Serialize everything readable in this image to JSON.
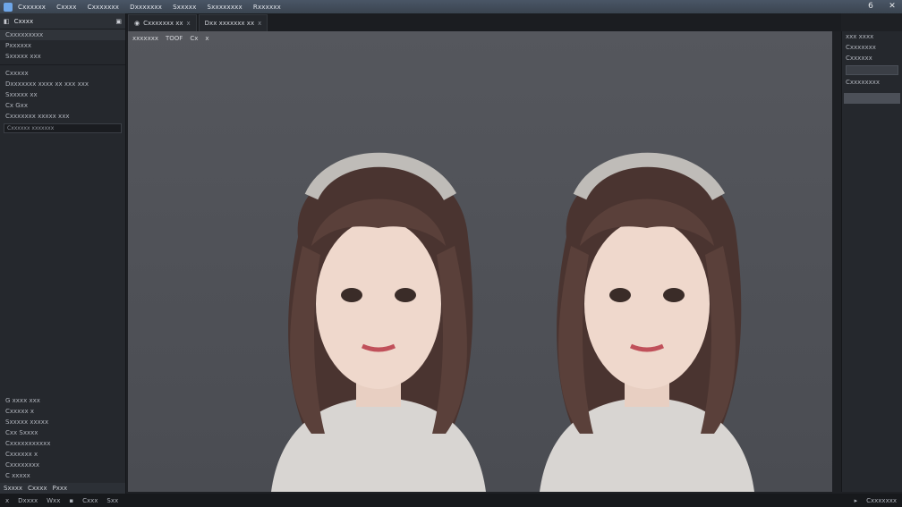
{
  "menubar": {
    "items": [
      "Cxxxxxx",
      "Cxxxx",
      "Cxxxxxxx",
      "Dxxxxxxx",
      "Sxxxxx",
      "Sxxxxxxxx",
      "Rxxxxxx"
    ],
    "counter": "6"
  },
  "left_panel": {
    "header_title": "Cxxxx",
    "rows": [
      "Cxxxxxxxxx",
      "Pxxxxxx",
      "Sxxxxx xxx",
      "Cxxxxx",
      "Dxxxxxxx xxxx xx xxx xxx",
      "Sxxxxx xx",
      "Cx Gxx",
      "Cxxxxxxx xxxxx xxx"
    ],
    "input_value": "Cxxxxxx xxxxxxx",
    "bottom_rows": [
      "G xxxx xxx",
      "Cxxxxx x",
      "Sxxxxx xxxxx",
      "Cxx Sxxxx",
      "Cxxxxxxxxxxx",
      "Cxxxxxx x",
      "Cxxxxxxxx",
      "C xxxxx"
    ],
    "footer": [
      "Sxxxx",
      "Cxxxx",
      "Pxxx"
    ]
  },
  "tabs": [
    {
      "label": "Cxxxxxxx xx",
      "close": "x"
    },
    {
      "label": "Dxx xxxxxxx xx",
      "close": "x"
    }
  ],
  "viewport": {
    "toolbar": [
      "xxxxxxx",
      "TOOF",
      "Cx",
      "x"
    ]
  },
  "right_panel": {
    "rows": [
      "xxx xxxx",
      "Cxxxxxxx",
      "Cxxxxxx",
      "Cxxxxxxxx"
    ]
  },
  "statusbar": {
    "left": [
      "x",
      "Dxxxx",
      "Wxx"
    ],
    "middle": [
      "Cxxx",
      "Sxx"
    ],
    "right": "Cxxxxxxx"
  },
  "colors": {
    "accent": "#6ea6e8",
    "canvas": "#505258"
  }
}
